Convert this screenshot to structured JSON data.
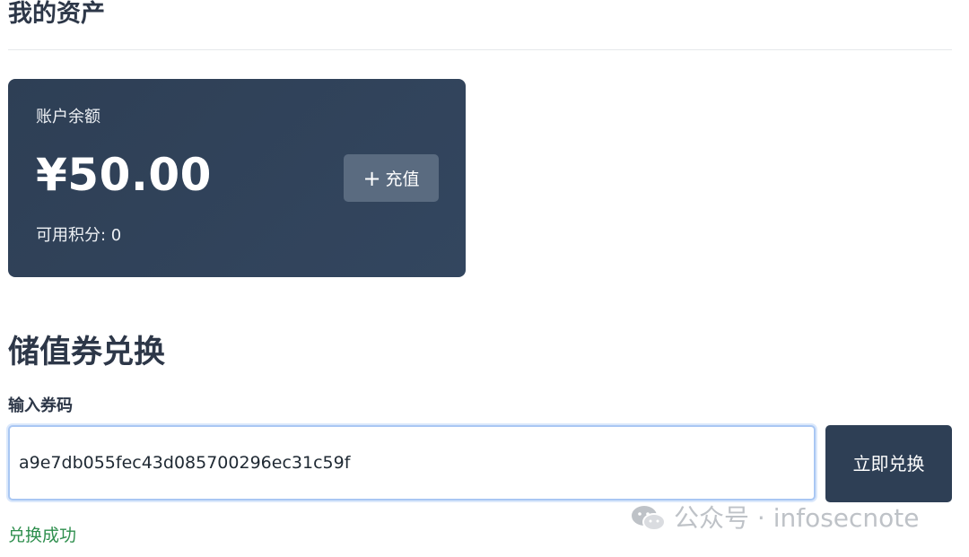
{
  "header": {
    "title": "我的资产"
  },
  "balance_card": {
    "label": "账户余额",
    "amount": "¥50.00",
    "recharge_label": "充值",
    "points_text": "可用积分: 0"
  },
  "voucher": {
    "section_title": "储值券兑换",
    "input_label": "输入券码",
    "input_value": "a9e7db055fec43d085700296ec31c59f",
    "redeem_label": "立即兑换",
    "status_message": "兑换成功"
  },
  "watermark": {
    "text": "公众号 · infosecnote"
  },
  "icons": {
    "plus": "plus-icon",
    "watermark": "wechat-icon"
  },
  "colors": {
    "card_background": "#2e3f55",
    "recharge_button": "#5a6b80",
    "redeem_button": "#2e3f55",
    "success_text": "#2f8f4e",
    "input_focus": "#a9c7f3"
  }
}
